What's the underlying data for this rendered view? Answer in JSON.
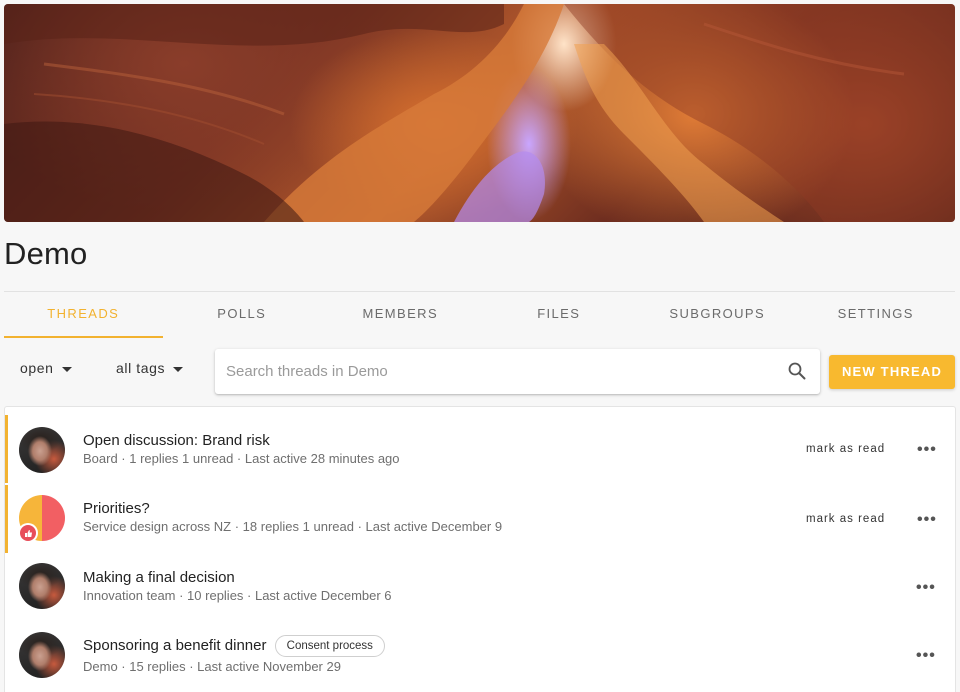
{
  "group": {
    "name": "Demo"
  },
  "tabs": [
    {
      "label": "THREADS",
      "active": true
    },
    {
      "label": "POLLS",
      "active": false
    },
    {
      "label": "MEMBERS",
      "active": false
    },
    {
      "label": "FILES",
      "active": false
    },
    {
      "label": "SUBGROUPS",
      "active": false
    },
    {
      "label": "SETTINGS",
      "active": false
    }
  ],
  "toolbar": {
    "status_filter": "open",
    "tag_filter": "all tags",
    "search_placeholder": "Search threads in Demo",
    "new_thread_label": "NEW THREAD"
  },
  "threads": [
    {
      "title": "Open discussion: Brand risk",
      "meta": "Board · 1 replies 1 unread · Last active 28 minutes ago",
      "unread": true,
      "action": "mark as read",
      "more": "•••"
    },
    {
      "title": "Priorities?",
      "meta": "Service design across NZ · 18 replies 1 unread · Last active December 9",
      "unread": true,
      "action": "mark as read",
      "more": "•••"
    },
    {
      "title": "Making a final decision",
      "meta": "Innovation team · 10 replies  · Last active December 6",
      "unread": false,
      "more": "•••"
    },
    {
      "title": "Sponsoring a benefit dinner",
      "tag": "Consent process",
      "meta": "Demo · 15 replies  · Last active November 29",
      "unread": false,
      "more": "•••"
    }
  ],
  "colors": {
    "accent": "#f2b230",
    "button": "#f8b92f",
    "poll_badge": "#e84e5a"
  }
}
